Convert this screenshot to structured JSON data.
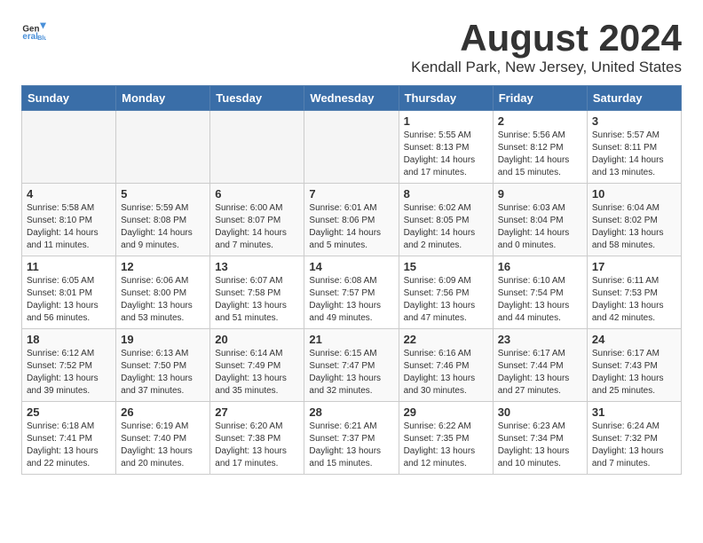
{
  "logo": {
    "general": "General",
    "blue": "Blue"
  },
  "title": "August 2024",
  "subtitle": "Kendall Park, New Jersey, United States",
  "days_of_week": [
    "Sunday",
    "Monday",
    "Tuesday",
    "Wednesday",
    "Thursday",
    "Friday",
    "Saturday"
  ],
  "weeks": [
    [
      {
        "day": "",
        "info": ""
      },
      {
        "day": "",
        "info": ""
      },
      {
        "day": "",
        "info": ""
      },
      {
        "day": "",
        "info": ""
      },
      {
        "day": "1",
        "info": "Sunrise: 5:55 AM\nSunset: 8:13 PM\nDaylight: 14 hours\nand 17 minutes."
      },
      {
        "day": "2",
        "info": "Sunrise: 5:56 AM\nSunset: 8:12 PM\nDaylight: 14 hours\nand 15 minutes."
      },
      {
        "day": "3",
        "info": "Sunrise: 5:57 AM\nSunset: 8:11 PM\nDaylight: 14 hours\nand 13 minutes."
      }
    ],
    [
      {
        "day": "4",
        "info": "Sunrise: 5:58 AM\nSunset: 8:10 PM\nDaylight: 14 hours\nand 11 minutes."
      },
      {
        "day": "5",
        "info": "Sunrise: 5:59 AM\nSunset: 8:08 PM\nDaylight: 14 hours\nand 9 minutes."
      },
      {
        "day": "6",
        "info": "Sunrise: 6:00 AM\nSunset: 8:07 PM\nDaylight: 14 hours\nand 7 minutes."
      },
      {
        "day": "7",
        "info": "Sunrise: 6:01 AM\nSunset: 8:06 PM\nDaylight: 14 hours\nand 5 minutes."
      },
      {
        "day": "8",
        "info": "Sunrise: 6:02 AM\nSunset: 8:05 PM\nDaylight: 14 hours\nand 2 minutes."
      },
      {
        "day": "9",
        "info": "Sunrise: 6:03 AM\nSunset: 8:04 PM\nDaylight: 14 hours\nand 0 minutes."
      },
      {
        "day": "10",
        "info": "Sunrise: 6:04 AM\nSunset: 8:02 PM\nDaylight: 13 hours\nand 58 minutes."
      }
    ],
    [
      {
        "day": "11",
        "info": "Sunrise: 6:05 AM\nSunset: 8:01 PM\nDaylight: 13 hours\nand 56 minutes."
      },
      {
        "day": "12",
        "info": "Sunrise: 6:06 AM\nSunset: 8:00 PM\nDaylight: 13 hours\nand 53 minutes."
      },
      {
        "day": "13",
        "info": "Sunrise: 6:07 AM\nSunset: 7:58 PM\nDaylight: 13 hours\nand 51 minutes."
      },
      {
        "day": "14",
        "info": "Sunrise: 6:08 AM\nSunset: 7:57 PM\nDaylight: 13 hours\nand 49 minutes."
      },
      {
        "day": "15",
        "info": "Sunrise: 6:09 AM\nSunset: 7:56 PM\nDaylight: 13 hours\nand 47 minutes."
      },
      {
        "day": "16",
        "info": "Sunrise: 6:10 AM\nSunset: 7:54 PM\nDaylight: 13 hours\nand 44 minutes."
      },
      {
        "day": "17",
        "info": "Sunrise: 6:11 AM\nSunset: 7:53 PM\nDaylight: 13 hours\nand 42 minutes."
      }
    ],
    [
      {
        "day": "18",
        "info": "Sunrise: 6:12 AM\nSunset: 7:52 PM\nDaylight: 13 hours\nand 39 minutes."
      },
      {
        "day": "19",
        "info": "Sunrise: 6:13 AM\nSunset: 7:50 PM\nDaylight: 13 hours\nand 37 minutes."
      },
      {
        "day": "20",
        "info": "Sunrise: 6:14 AM\nSunset: 7:49 PM\nDaylight: 13 hours\nand 35 minutes."
      },
      {
        "day": "21",
        "info": "Sunrise: 6:15 AM\nSunset: 7:47 PM\nDaylight: 13 hours\nand 32 minutes."
      },
      {
        "day": "22",
        "info": "Sunrise: 6:16 AM\nSunset: 7:46 PM\nDaylight: 13 hours\nand 30 minutes."
      },
      {
        "day": "23",
        "info": "Sunrise: 6:17 AM\nSunset: 7:44 PM\nDaylight: 13 hours\nand 27 minutes."
      },
      {
        "day": "24",
        "info": "Sunrise: 6:17 AM\nSunset: 7:43 PM\nDaylight: 13 hours\nand 25 minutes."
      }
    ],
    [
      {
        "day": "25",
        "info": "Sunrise: 6:18 AM\nSunset: 7:41 PM\nDaylight: 13 hours\nand 22 minutes."
      },
      {
        "day": "26",
        "info": "Sunrise: 6:19 AM\nSunset: 7:40 PM\nDaylight: 13 hours\nand 20 minutes."
      },
      {
        "day": "27",
        "info": "Sunrise: 6:20 AM\nSunset: 7:38 PM\nDaylight: 13 hours\nand 17 minutes."
      },
      {
        "day": "28",
        "info": "Sunrise: 6:21 AM\nSunset: 7:37 PM\nDaylight: 13 hours\nand 15 minutes."
      },
      {
        "day": "29",
        "info": "Sunrise: 6:22 AM\nSunset: 7:35 PM\nDaylight: 13 hours\nand 12 minutes."
      },
      {
        "day": "30",
        "info": "Sunrise: 6:23 AM\nSunset: 7:34 PM\nDaylight: 13 hours\nand 10 minutes."
      },
      {
        "day": "31",
        "info": "Sunrise: 6:24 AM\nSunset: 7:32 PM\nDaylight: 13 hours\nand 7 minutes."
      }
    ]
  ],
  "colors": {
    "header_bg": "#3a6ea8",
    "row_alt1": "#ffffff",
    "row_alt2": "#f5f5f5"
  }
}
